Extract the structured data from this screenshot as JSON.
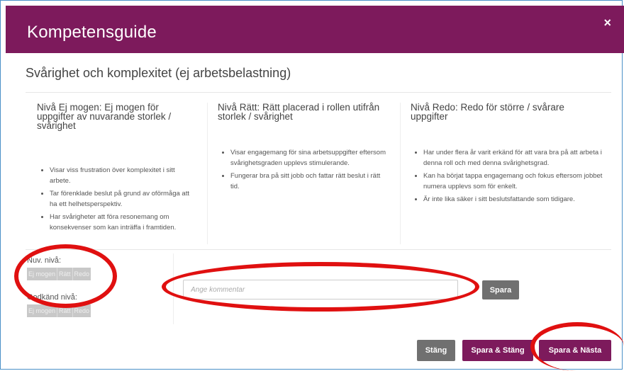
{
  "modal": {
    "title": "Kompetensguide",
    "close": "×"
  },
  "section_title": "Svårighet och komplexitet (ej arbetsbelastning)",
  "columns": [
    {
      "heading": "Nivå Ej mogen: Ej mogen för uppgifter av nuvarande storlek / svårighet",
      "bullets": [
        "Visar viss frustration över komplexitet i sitt arbete.",
        "Tar förenklade beslut på grund av oförmåga att ha ett helhetsperspektiv.",
        "Har svårigheter att föra resonemang om konsekvenser som kan inträffa i framtiden."
      ]
    },
    {
      "heading": "Nivå Rätt: Rätt placerad i rollen utifrån storlek / svårighet",
      "bullets": [
        "Visar engagemang för sina arbetsuppgifter eftersom svårighetsgraden upplevs stimulerande.",
        "Fungerar bra på sitt jobb och fattar rätt beslut i rätt tid."
      ]
    },
    {
      "heading": "Nivå Redo: Redo för större / svårare uppgifter",
      "bullets": [
        "Har under flera år varit erkänd för att vara bra på att arbeta i denna roll och med denna svårighetsgrad.",
        "Kan ha börjat tappa engagemang och fokus eftersom jobbet numera upplevs som för enkelt.",
        "Är inte lika säker i sitt beslutsfattande som tidigare."
      ]
    }
  ],
  "current_level": {
    "label": "Nuv. nivå:",
    "options": [
      "Ej mogen",
      "Rätt",
      "Redo"
    ]
  },
  "approved_level": {
    "label": "Godkänd nivå:",
    "options": [
      "Ej mogen",
      "Rätt",
      "Redo"
    ]
  },
  "comment": {
    "placeholder": "Ange kommentar",
    "value": ""
  },
  "buttons": {
    "save": "Spara",
    "close": "Stäng",
    "save_close": "Spara & Stäng",
    "save_next": "Spara & Nästa"
  },
  "colors": {
    "brand": "#7d1a5c",
    "grey_button": "#707070",
    "annotation": "#e01010"
  }
}
